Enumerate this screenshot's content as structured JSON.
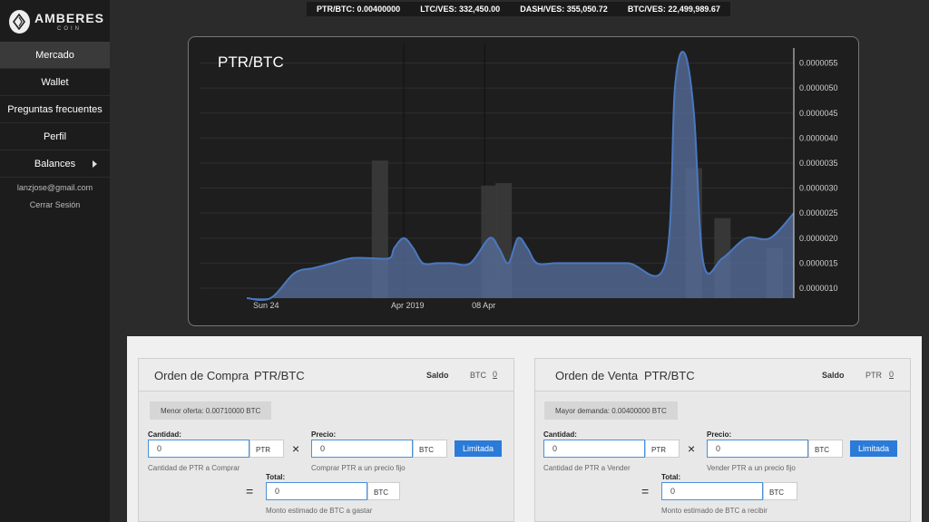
{
  "brand": {
    "name": "AMBERES",
    "sub": "COIN"
  },
  "sidebar": {
    "items": [
      {
        "label": "Mercado"
      },
      {
        "label": "Wallet"
      },
      {
        "label": "Preguntas frecuentes"
      },
      {
        "label": "Perfil"
      },
      {
        "label": "Balances"
      }
    ],
    "email": "lanzjose@gmail.com",
    "logout": "Cerrar Sesión"
  },
  "ticker": [
    "PTR/BTC: 0.00400000",
    "LTC/VES: 332,450.00",
    "DASH/VES: 355,050.72",
    "BTC/VES: 22,499,989.67"
  ],
  "colors": {
    "accent": "#2b7bd8",
    "line": "#4a78c0",
    "area": "#5870a0"
  },
  "chart_data": {
    "type": "area",
    "title": "PTR/BTC",
    "x_ticks": [
      "Sun 24",
      "Apr 2019",
      "08 Apr"
    ],
    "y_ticks": [
      "0.0000010",
      "0.0000015",
      "0.0000020",
      "0.0000025",
      "0.0000030",
      "0.0000035",
      "0.0000040",
      "0.0000045",
      "0.0000050",
      "0.0000055"
    ],
    "ylim": [
      8e-07,
      5.8e-06
    ],
    "x_domain": [
      0,
      100
    ],
    "series": [
      {
        "x": [
          0,
          5,
          10,
          14,
          18,
          22,
          26,
          30,
          31,
          33,
          35,
          37,
          40,
          43,
          47,
          51,
          53,
          55,
          57,
          59,
          61,
          65,
          70,
          80,
          88,
          90,
          92,
          94,
          96,
          100,
          105,
          110,
          115
        ],
        "y": [
          8e-07,
          8e-07,
          1.3e-06,
          1.4e-06,
          1.5e-06,
          1.6e-06,
          1.6e-06,
          1.6e-06,
          1.8e-06,
          2e-06,
          1.8e-06,
          1.5e-06,
          1.5e-06,
          1.5e-06,
          1.5e-06,
          2e-06,
          1.8e-06,
          1.5e-06,
          2e-06,
          1.8e-06,
          1.5e-06,
          1.5e-06,
          1.5e-06,
          1.5e-06,
          1.5e-06,
          5e-06,
          5.7e-06,
          4.5e-06,
          1.5e-06,
          1.6e-06,
          2e-06,
          2e-06,
          2.5e-06
        ]
      }
    ],
    "volume": [
      {
        "x": 28,
        "v": 0.55
      },
      {
        "x": 51,
        "v": 0.45
      },
      {
        "x": 54,
        "v": 0.46
      },
      {
        "x": 94,
        "v": 0.52
      },
      {
        "x": 100,
        "v": 0.32
      },
      {
        "x": 111,
        "v": 0.2
      }
    ],
    "grid": true
  },
  "buy": {
    "title": "Orden de Compra",
    "pair": "PTR/BTC",
    "saldo_label": "Saldo",
    "saldo_cur": "BTC",
    "saldo_val": "0",
    "info": "Menor oferta: 0.00710000 BTC",
    "cantidad_label": "Cantidad:",
    "cantidad_val": "0",
    "cantidad_unit": "PTR",
    "cantidad_help": "Cantidad de PTR a Comprar",
    "times": "×",
    "precio_label": "Precio:",
    "precio_val": "0",
    "precio_unit": "BTC",
    "precio_help": "Comprar PTR a un precio fijo",
    "button": "Limitada",
    "equals": "=",
    "total_label": "Total:",
    "total_val": "0",
    "total_unit": "BTC",
    "total_help": "Monto estimado de BTC a gastar"
  },
  "sell": {
    "title": "Orden de Venta",
    "pair": "PTR/BTC",
    "saldo_label": "Saldo",
    "saldo_cur": "PTR",
    "saldo_val": "0",
    "info": "Mayor demanda: 0.00400000 BTC",
    "cantidad_label": "Cantidad:",
    "cantidad_val": "0",
    "cantidad_unit": "PTR",
    "cantidad_help": "Cantidad de PTR a Vender",
    "times": "×",
    "precio_label": "Precio:",
    "precio_val": "0",
    "precio_unit": "BTC",
    "precio_help": "Vender PTR a un precio fijo",
    "button": "Limitada",
    "equals": "=",
    "total_label": "Total:",
    "total_val": "0",
    "total_unit": "BTC",
    "total_help": "Monto estimado de BTC a recibir"
  }
}
